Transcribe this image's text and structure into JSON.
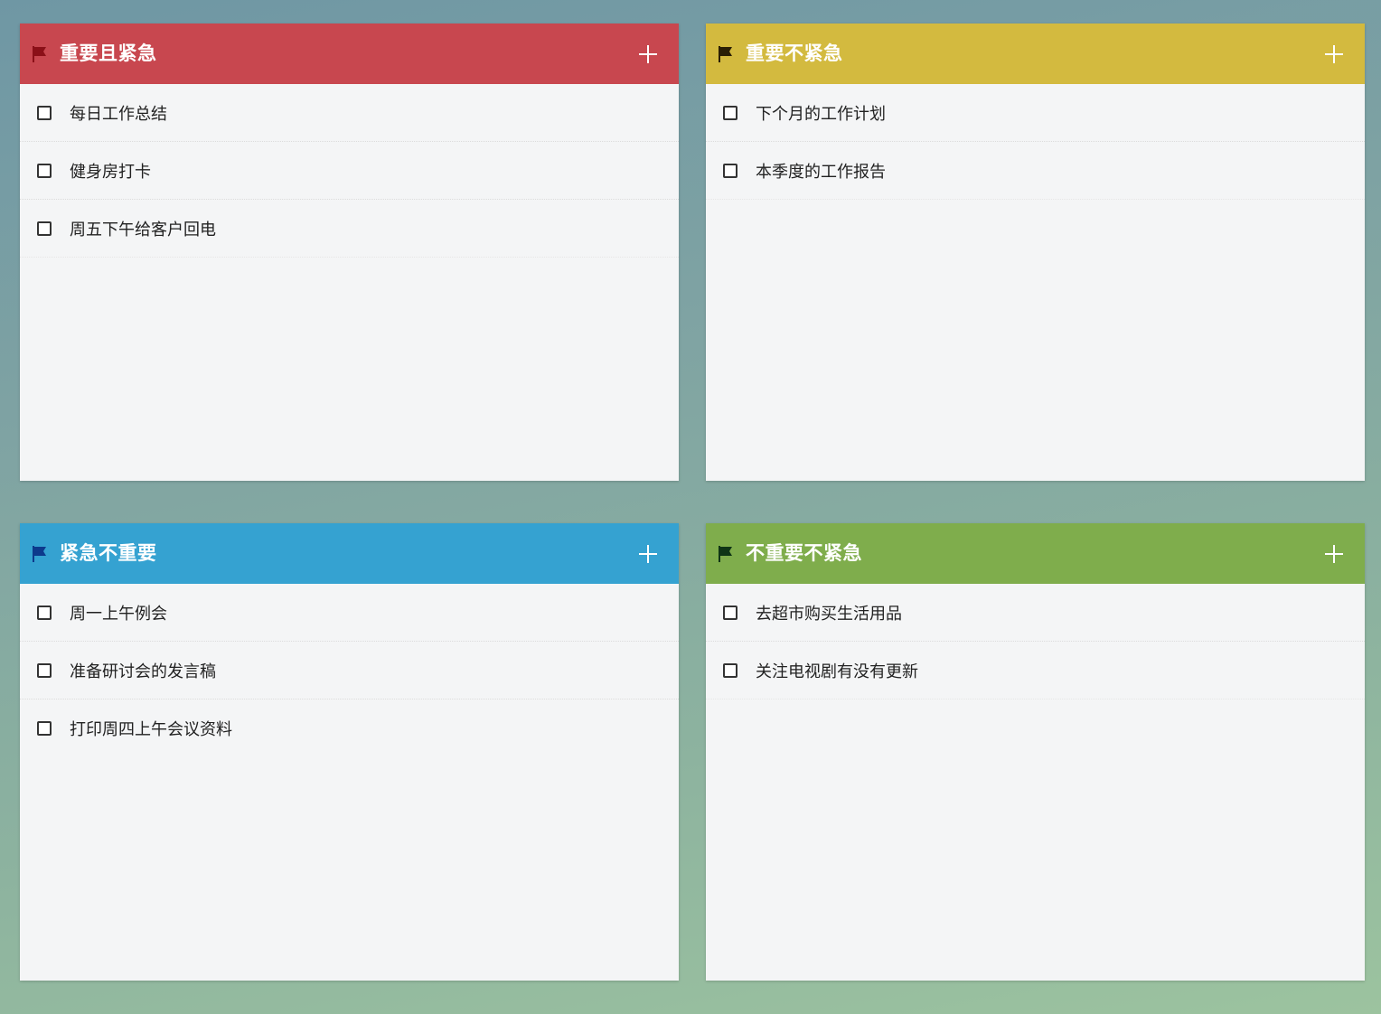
{
  "quadrants": [
    {
      "title": "重要且紧急",
      "header_color": "#c8474f",
      "flag_color": "#8b1018",
      "flag_icon": "flag-icon",
      "add_icon": "plus-icon",
      "tasks": [
        {
          "label": "每日工作总结",
          "checked": false
        },
        {
          "label": "健身房打卡",
          "checked": false
        },
        {
          "label": "周五下午给客户回电",
          "checked": false
        }
      ]
    },
    {
      "title": "重要不紧急",
      "header_color": "#d3ba3f",
      "flag_color": "#2a1f05",
      "flag_icon": "flag-icon",
      "add_icon": "plus-icon",
      "tasks": [
        {
          "label": "下个月的工作计划",
          "checked": false
        },
        {
          "label": "本季度的工作报告",
          "checked": false
        }
      ]
    },
    {
      "title": "紧急不重要",
      "header_color": "#35a2d1",
      "flag_color": "#0d3a8c",
      "flag_icon": "flag-icon",
      "add_icon": "plus-icon",
      "tasks": [
        {
          "label": "周一上午例会",
          "checked": false
        },
        {
          "label": "准备研讨会的发言稿",
          "checked": false
        },
        {
          "label": "打印周四上午会议资料",
          "checked": false
        }
      ]
    },
    {
      "title": "不重要不紧急",
      "header_color": "#7fad4c",
      "flag_color": "#0f3516",
      "flag_icon": "flag-icon",
      "add_icon": "plus-icon",
      "tasks": [
        {
          "label": "去超市购买生活用品",
          "checked": false
        },
        {
          "label": "关注电视剧有没有更新",
          "checked": false
        }
      ]
    }
  ]
}
